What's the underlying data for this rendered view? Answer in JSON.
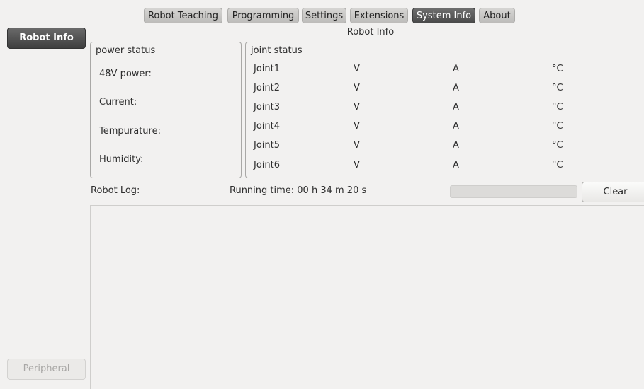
{
  "tabs": [
    {
      "label": "Robot Teaching",
      "active": false
    },
    {
      "label": "Programming",
      "active": false
    },
    {
      "label": "Settings",
      "active": false
    },
    {
      "label": "Extensions",
      "active": false
    },
    {
      "label": "System Info",
      "active": true
    },
    {
      "label": "About",
      "active": false
    }
  ],
  "sidebar": {
    "robot_info": "Robot Info",
    "peripheral": "Peripheral"
  },
  "section_title": "Robot Info",
  "power": {
    "title": "power status",
    "labels": [
      "48V power:",
      "Current:",
      "Tempurature:",
      "Humidity:"
    ]
  },
  "joint": {
    "title": "joint status",
    "rows": [
      {
        "name": "Joint1",
        "v": "V",
        "a": "A",
        "t": "°C"
      },
      {
        "name": "Joint2",
        "v": "V",
        "a": "A",
        "t": "°C"
      },
      {
        "name": "Joint3",
        "v": "V",
        "a": "A",
        "t": "°C"
      },
      {
        "name": "Joint4",
        "v": "V",
        "a": "A",
        "t": "°C"
      },
      {
        "name": "Joint5",
        "v": "V",
        "a": "A",
        "t": "°C"
      },
      {
        "name": "Joint6",
        "v": "V",
        "a": "A",
        "t": "°C"
      }
    ]
  },
  "log": {
    "label": "Robot Log:",
    "running_time": "Running time: 00 h 34 m 20 s",
    "clear": "Clear"
  }
}
